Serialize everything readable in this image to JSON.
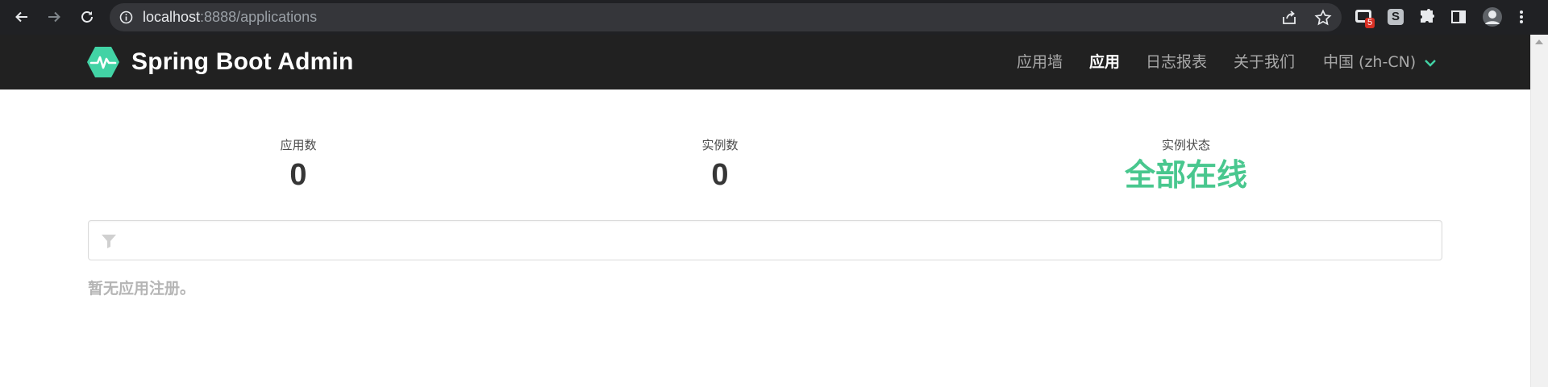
{
  "browser": {
    "url_host": "localhost",
    "url_rest": ":8888/applications",
    "extension_badge": "5",
    "s_extension_label": "S"
  },
  "navbar": {
    "brand": "Spring Boot Admin",
    "items": [
      {
        "label": "应用墙",
        "active": false
      },
      {
        "label": "应用",
        "active": true
      },
      {
        "label": "日志报表",
        "active": false
      },
      {
        "label": "关于我们",
        "active": false
      }
    ],
    "language": "中国 (zh-CN)"
  },
  "stats": {
    "applications": {
      "label": "应用数",
      "value": "0"
    },
    "instances": {
      "label": "实例数",
      "value": "0"
    },
    "status": {
      "label": "实例状态",
      "value": "全部在线"
    }
  },
  "filter": {
    "placeholder": "",
    "value": ""
  },
  "empty_message": "暂无应用注册。",
  "colors": {
    "navbar_bg": "#212121",
    "brand_accent": "#42d3a5",
    "status_ok": "#48c78e"
  }
}
